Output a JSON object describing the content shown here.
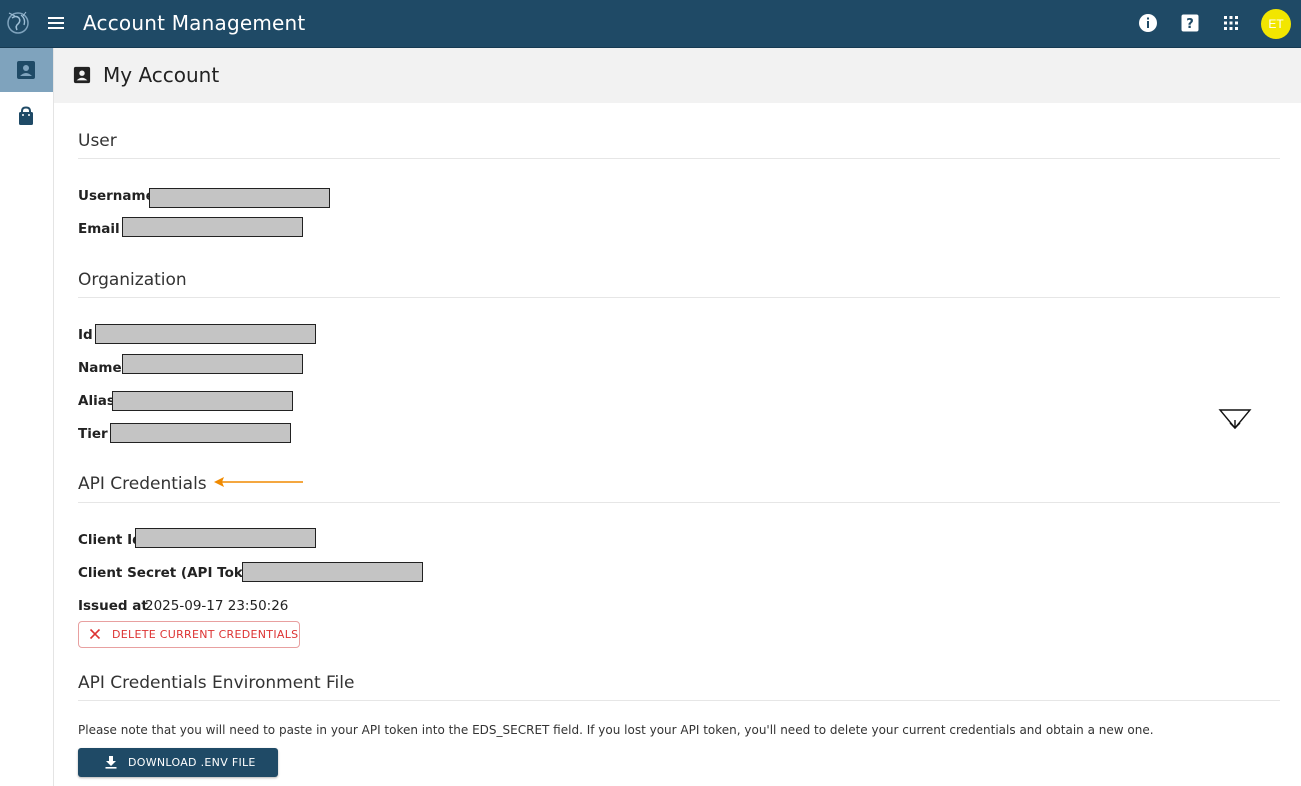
{
  "header": {
    "app_title": "Account Management",
    "avatar_initials": "ET",
    "icons": [
      "info-icon",
      "help-icon",
      "apps-grid-icon"
    ],
    "colors": {
      "bar": "#1f4a66",
      "avatar": "#f2e600"
    }
  },
  "sidebar": {
    "items": [
      {
        "icon": "account-box-icon",
        "active": true
      },
      {
        "icon": "shopping-bag-icon",
        "active": false
      }
    ]
  },
  "page": {
    "title": "My Account"
  },
  "user": {
    "title": "User",
    "fields": [
      {
        "label": "Username"
      },
      {
        "label": "Email"
      }
    ]
  },
  "organization": {
    "title": "Organization",
    "fields": [
      {
        "label": "Id"
      },
      {
        "label": "Name"
      },
      {
        "label": "Alias"
      },
      {
        "label": "Tier"
      }
    ]
  },
  "credentials": {
    "title": "API Credentials",
    "fields": [
      {
        "label": "Client Id"
      },
      {
        "label": "Client Secret (API Token)"
      }
    ],
    "issued_label": "Issued at",
    "issued_value": "2025-09-17 23:50:26",
    "delete_label": "DELETE CURRENT CREDENTIALS",
    "annotation_color": "#f08a00"
  },
  "env_file": {
    "title": "API Credentials Environment File",
    "note": "Please note that you will need to paste in your API token into the EDS_SECRET field. If you lost your API token, you'll need to delete your current credentials and obtain a new one.",
    "download_label": "DOWNLOAD .ENV FILE"
  }
}
